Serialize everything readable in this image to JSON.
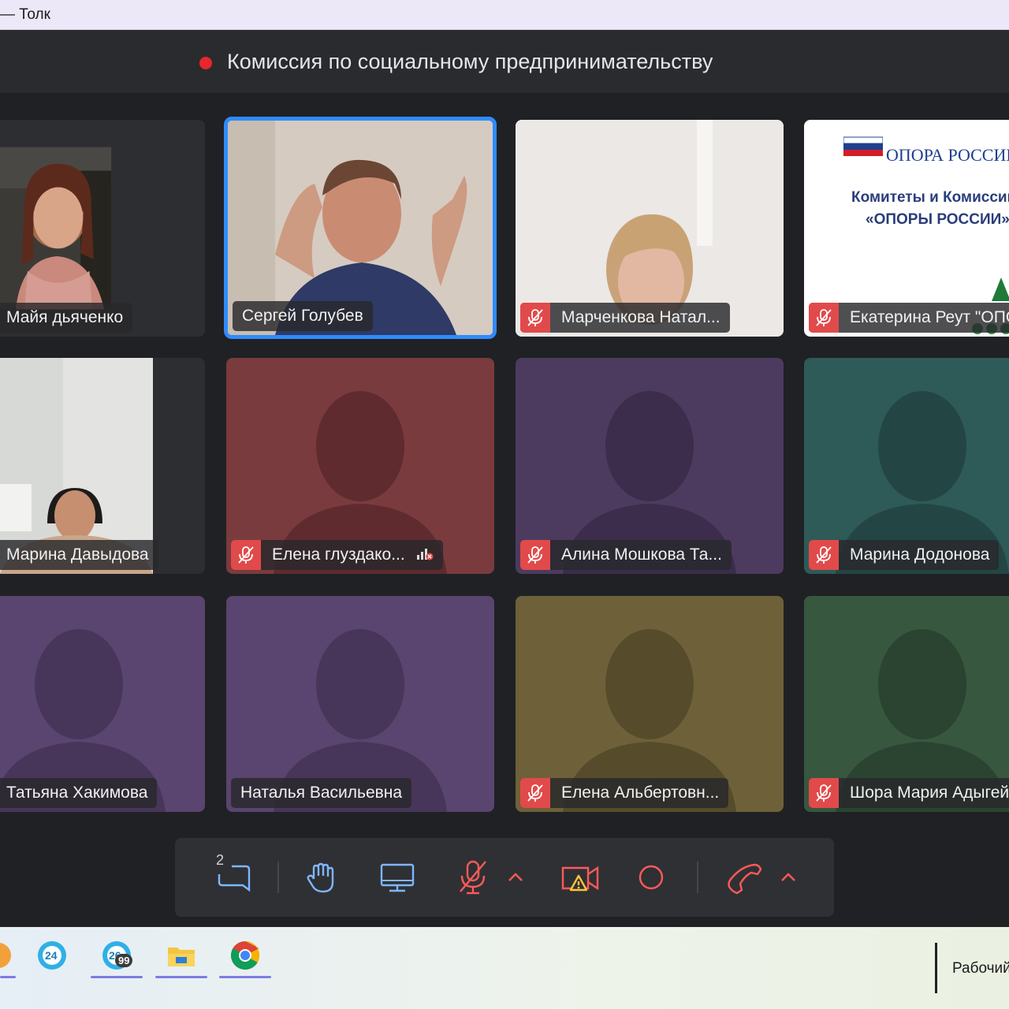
{
  "window": {
    "title": "— Толк"
  },
  "meeting": {
    "title": "Комиссия по социальному предпринимательству",
    "recording_color": "#e8262c"
  },
  "participants": [
    {
      "name": "Майя дьяченко",
      "muted": false
    },
    {
      "name": "Сергей Голубев",
      "muted": false,
      "active_speaker": true
    },
    {
      "name": "Марченкова Натал...",
      "muted": true
    },
    {
      "name": "Екатерина Реут \"ОПОРА РОССИИ\"",
      "muted": true
    },
    {
      "name": "Марина Давыдова",
      "muted": false
    },
    {
      "name": "Елена глуздако...",
      "muted": true,
      "poor_connection": true
    },
    {
      "name": "Алина Мошкова Та...",
      "muted": true
    },
    {
      "name": "Марина Додонова",
      "muted": true
    },
    {
      "name": "Татьяна Хакимова",
      "muted": false
    },
    {
      "name": "Наталья Васильевна",
      "muted": false
    },
    {
      "name": "Елена Альбертовн...",
      "muted": true
    },
    {
      "name": "Шора Мария Адыгейская",
      "muted": true
    }
  ],
  "slide": {
    "logo_text": "ОПОРА РОССИИ",
    "line1": "Комитеты и Комиссии",
    "line2": "«ОПОРЫ РОССИИ»"
  },
  "toolbar": {
    "chat_count": "2",
    "buttons": [
      "chat-icon",
      "raise-hand-icon",
      "screen-share-icon",
      "mic-off-icon",
      "camera-off-icon",
      "record-icon",
      "end-call-icon"
    ]
  },
  "taskbar": {
    "badges": [
      "24",
      "26",
      "99"
    ],
    "desktop_label": "Рабочий стол"
  },
  "colors": {
    "accent_active": "#2f8bff",
    "mute_red": "#e14a4a",
    "tile_red": "#7a3b3e",
    "tile_purple": "#4c3b5f",
    "tile_teal": "#2e5a58",
    "tile_olive": "#6e6139",
    "tile_green": "#37573f",
    "tile_violet": "#5a4470"
  }
}
